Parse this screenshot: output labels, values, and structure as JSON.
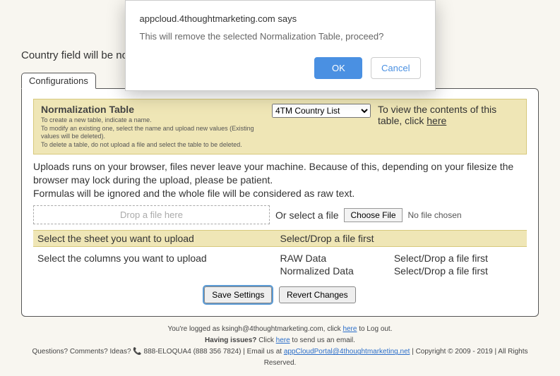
{
  "modal": {
    "origin": "appcloud.4thoughtmarketing.com says",
    "message": "This will remove the selected Normalization Table, proceed?",
    "ok": "OK",
    "cancel": "Cancel"
  },
  "intro": "Country field will be norr",
  "tabs": {
    "configurations": "Configurations"
  },
  "norm": {
    "title": "Normalization Table",
    "hint1": "To create a new table, indicate a name.",
    "hint2": "To modify an existing one, select the name and upload new values (Existing values will be deleted).",
    "hint3": "To delete a table, do not upload a file and select the table to be deleted.",
    "dropdown_value": "4TM Country List",
    "view_prefix": "To view the contents of this table, click ",
    "view_link": "here"
  },
  "upload": {
    "info1": "Uploads runs on your browser, files never leave your machine. Because of this, depending on your filesize the browser may lock during the upload, please be patient.",
    "info2": "Formulas will be ignored and the whole file will be considered as raw text.",
    "drop_label": "Drop a file here",
    "or_select": "Or select a file",
    "choose_btn": "Choose File",
    "no_file": "No file chosen"
  },
  "sheet": {
    "left": "Select the sheet you want to upload",
    "right": "Select/Drop a file first"
  },
  "columns": {
    "left": "Select the columns you want to upload",
    "raw_label": "RAW Data",
    "raw_value": "Select/Drop a file first",
    "norm_label": "Normalized Data",
    "norm_value": "Select/Drop a file first"
  },
  "buttons": {
    "save": "Save Settings",
    "revert": "Revert Changes"
  },
  "footer": {
    "logged_prefix": "You're logged as ksingh@4thoughtmarketing.com, click ",
    "logged_link": "here",
    "logged_suffix": " to Log out.",
    "issues_prefix": "Having issues? ",
    "issues_mid": "Click ",
    "issues_link": "here",
    "issues_suffix": " to send us an email.",
    "contact_prefix": "Questions? Comments? Ideas? ",
    "phone": " 888-ELOQUA4 (888 356 7824) | Email us at ",
    "email_link": "appCloudPortal@4thoughtmarketing.net",
    "copyright": " | Copyright © 2009 - 2019 | All Rights Reserved."
  }
}
